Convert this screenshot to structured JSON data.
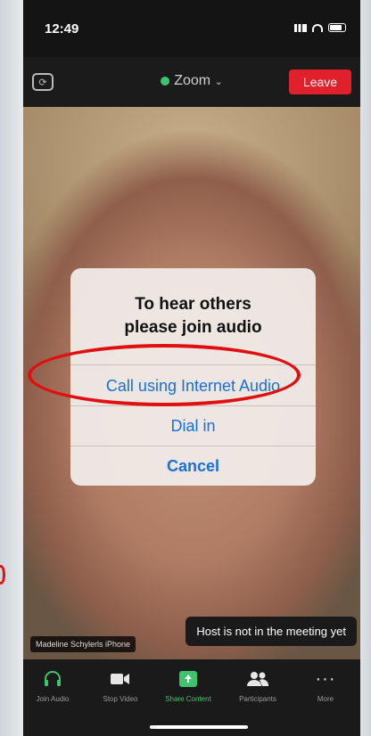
{
  "status": {
    "time": "12:49"
  },
  "topbar": {
    "meeting_title": "Zoom",
    "leave_label": "Leave"
  },
  "video": {
    "participant_name": "Madeline Schylerls iPhone",
    "host_notice": "Host is not in the meeting yet"
  },
  "dialog": {
    "title_line1": "To hear others",
    "title_line2": "please join audio",
    "options": [
      "Call using Internet Audio",
      "Dial in",
      "Cancel"
    ]
  },
  "toolbar": {
    "items": [
      "Join Audio",
      "Stop Video",
      "Share Content",
      "Participants",
      "More"
    ]
  },
  "colors": {
    "leave": "#e0202a",
    "link": "#1a6fd8",
    "annotation": "#e01010",
    "share": "#3ec46d"
  }
}
